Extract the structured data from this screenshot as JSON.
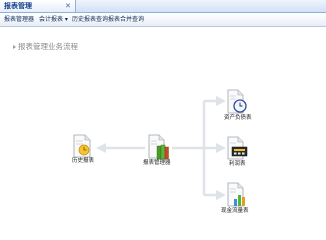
{
  "tab": {
    "title": "报表管理",
    "close": "✕"
  },
  "menu": [
    {
      "label": "报表管理器"
    },
    {
      "label": "会计报表 ▾"
    },
    {
      "label": "历史报表查询"
    },
    {
      "label": "报表合并查询"
    }
  ],
  "page": {
    "heading": "报表管理业务流程"
  },
  "nodes": {
    "history": {
      "label": "历史报表",
      "icon": "clock-document-icon"
    },
    "manager": {
      "label": "报表管理器",
      "icon": "books-document-icon"
    },
    "balance": {
      "label": "资产负债表",
      "icon": "clock-document-icon"
    },
    "profit": {
      "label": "利润表",
      "icon": "calculator-document-icon"
    },
    "cashflow": {
      "label": "现金流量表",
      "icon": "bar-chart-document-icon"
    }
  },
  "colors": {
    "arrow": "#dfe3e8",
    "accent": "#15428b"
  }
}
